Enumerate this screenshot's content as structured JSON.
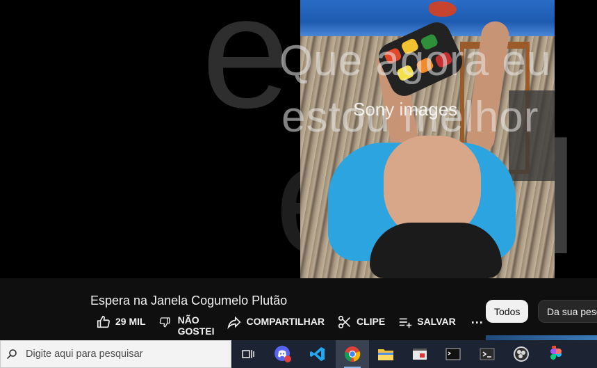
{
  "video": {
    "overlay_line1": "Que agora eu",
    "overlay_line2": "estou melhor",
    "watermark": "Sony images"
  },
  "below_video": {
    "title": "Espera na Janela Cogumelo Plutão",
    "actions": {
      "like_count": "29 MIL",
      "dislike_line1": "NÃO",
      "dislike_line2": "GOSTEI",
      "share": "COMPARTILHAR",
      "clip": "CLIPE",
      "save": "SALVAR",
      "more": "..."
    },
    "chips": {
      "all": "Todos",
      "channel": "Da sua pesquisa"
    }
  },
  "taskbar": {
    "search_placeholder": "Digite aqui para pesquisar",
    "apps": [
      "task-view-icon",
      "discord-icon",
      "vscode-icon",
      "chrome-icon",
      "file-explorer-icon",
      "app-window-icon",
      "terminal-icon",
      "powershell-icon",
      "obs-icon",
      "figma-icon"
    ],
    "active_app": "chrome-icon"
  }
}
